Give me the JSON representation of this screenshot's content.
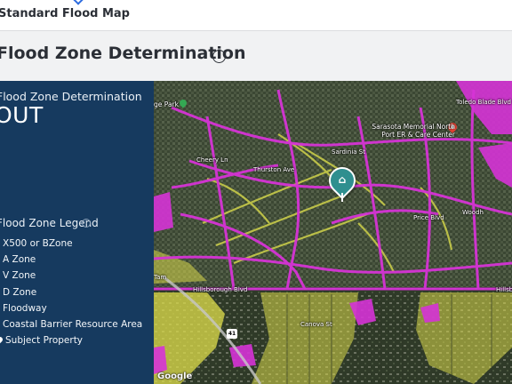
{
  "topbar": {
    "tab_label": "Standard Flood Map"
  },
  "section": {
    "title": "Flood Zone Determination",
    "info_icon": "info-icon"
  },
  "panel": {
    "heading": "Flood Zone Determination",
    "result": "OUT",
    "legend_title": "Flood Zone Legend",
    "legend_info_icon": "info-icon",
    "legend_items": [
      {
        "label": "X500 or BZone",
        "color": "#e8e05a"
      },
      {
        "label": "A Zone",
        "color": "#d633d6"
      },
      {
        "label": "V Zone",
        "color": "#9a3bd6"
      },
      {
        "label": "D Zone",
        "color": "#6ab3e6"
      },
      {
        "label": "Floodway",
        "color": "#2e6fd1"
      },
      {
        "label": "Coastal Barrier Resource Area",
        "color": "#47a86b"
      },
      {
        "label": "Subject Property",
        "icon": "map-pin-icon"
      }
    ],
    "background_color": "#163a5f"
  },
  "map": {
    "street_labels": [
      "ge Park",
      "Hillsborough Blvd",
      "Hillsboro",
      "Hillsborough Blvd",
      "Woodh",
      "Price Blvd",
      "Sardinia St",
      "Thurston Ave",
      "Canova St",
      "Cheery Ln",
      "Tam",
      "Toledo Blade Blvd",
      "41"
    ],
    "poi_label": "Sarasota Memorial North Port ER & Care Center",
    "attribution": "Google",
    "colors": {
      "flood_a": "#d633d6",
      "flood_x500": "#d8d84a",
      "aerial_dark": "#3b4733",
      "aerial_light": "#6d7560",
      "subject_marker": "#2f8f8f"
    }
  }
}
